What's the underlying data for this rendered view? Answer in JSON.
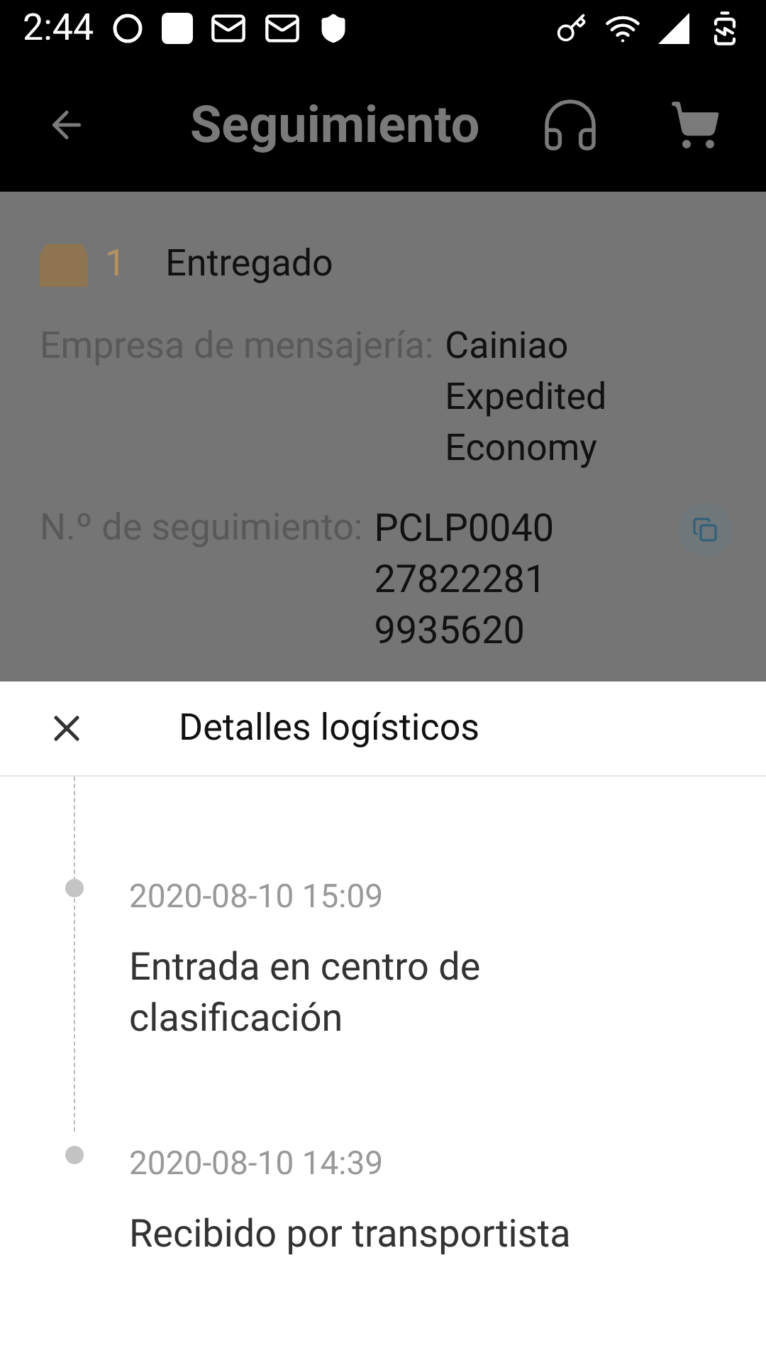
{
  "status_bar": {
    "time": "2:44"
  },
  "header": {
    "title": "Seguimiento"
  },
  "package": {
    "count": "1",
    "status": "Entregado"
  },
  "details": [
    {
      "label": "Empresa de mensajería:",
      "value": "Cainiao Expedited Economy",
      "copyable": false
    },
    {
      "label": "N.º de seguimiento:",
      "value": "PCLP0040278222819935620",
      "copyable": true
    }
  ],
  "sheet": {
    "title": "Detalles logísticos"
  },
  "events": [
    {
      "time": "2020-08-10 15:09",
      "description": "Entrada en centro de clasificación"
    },
    {
      "time": "2020-08-10 14:39",
      "description": "Recibido por transportista"
    }
  ]
}
